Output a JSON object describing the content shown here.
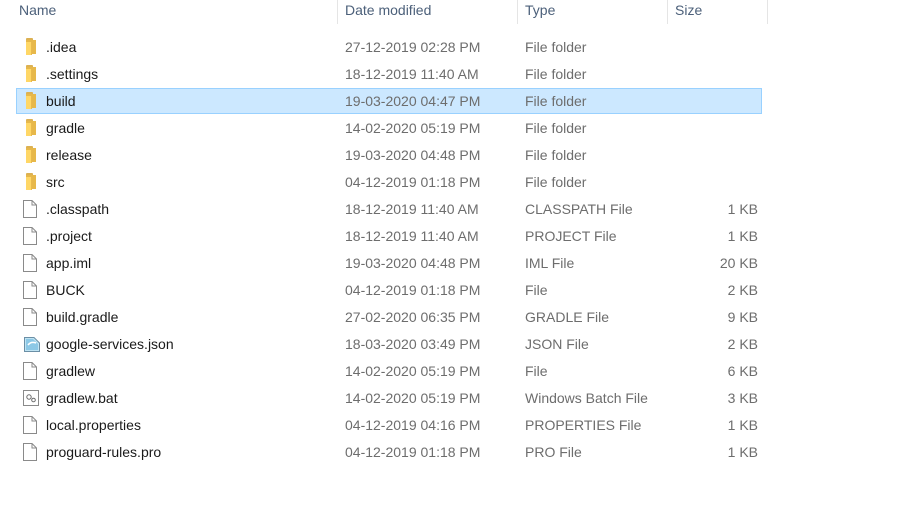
{
  "columns": {
    "name": "Name",
    "date": "Date modified",
    "type": "Type",
    "size": "Size"
  },
  "files": [
    {
      "name": ".idea",
      "date": "27-12-2019 02:28 PM",
      "type": "File folder",
      "size": "",
      "icon": "folder-icon"
    },
    {
      "name": ".settings",
      "date": "18-12-2019 11:40 AM",
      "type": "File folder",
      "size": "",
      "icon": "folder-icon"
    },
    {
      "name": "build",
      "date": "19-03-2020 04:47 PM",
      "type": "File folder",
      "size": "",
      "icon": "folder-icon",
      "selected": true
    },
    {
      "name": "gradle",
      "date": "14-02-2020 05:19 PM",
      "type": "File folder",
      "size": "",
      "icon": "folder-icon"
    },
    {
      "name": "release",
      "date": "19-03-2020 04:48 PM",
      "type": "File folder",
      "size": "",
      "icon": "folder-icon"
    },
    {
      "name": "src",
      "date": "04-12-2019 01:18 PM",
      "type": "File folder",
      "size": "",
      "icon": "folder-icon"
    },
    {
      "name": ".classpath",
      "date": "18-12-2019 11:40 AM",
      "type": "CLASSPATH File",
      "size": "1 KB",
      "icon": "file-icon"
    },
    {
      "name": ".project",
      "date": "18-12-2019 11:40 AM",
      "type": "PROJECT File",
      "size": "1 KB",
      "icon": "file-icon"
    },
    {
      "name": "app.iml",
      "date": "19-03-2020 04:48 PM",
      "type": "IML File",
      "size": "20 KB",
      "icon": "file-icon"
    },
    {
      "name": "BUCK",
      "date": "04-12-2019 01:18 PM",
      "type": "File",
      "size": "2 KB",
      "icon": "file-icon"
    },
    {
      "name": "build.gradle",
      "date": "27-02-2020 06:35 PM",
      "type": "GRADLE File",
      "size": "9 KB",
      "icon": "file-icon"
    },
    {
      "name": "google-services.json",
      "date": "18-03-2020 03:49 PM",
      "type": "JSON File",
      "size": "2 KB",
      "icon": "json-file-icon"
    },
    {
      "name": "gradlew",
      "date": "14-02-2020 05:19 PM",
      "type": "File",
      "size": "6 KB",
      "icon": "file-icon"
    },
    {
      "name": "gradlew.bat",
      "date": "14-02-2020 05:19 PM",
      "type": "Windows Batch File",
      "size": "3 KB",
      "icon": "batch-file-icon"
    },
    {
      "name": "local.properties",
      "date": "04-12-2019 04:16 PM",
      "type": "PROPERTIES File",
      "size": "1 KB",
      "icon": "file-icon"
    },
    {
      "name": "proguard-rules.pro",
      "date": "04-12-2019 01:18 PM",
      "type": "PRO File",
      "size": "1 KB",
      "icon": "file-icon"
    }
  ],
  "colors": {
    "selection_bg": "#cce8ff",
    "selection_border": "#99d1ff",
    "header_text": "#4c607a",
    "detail_text": "#6d6d6d",
    "folder_yellow": "#ffd766"
  }
}
